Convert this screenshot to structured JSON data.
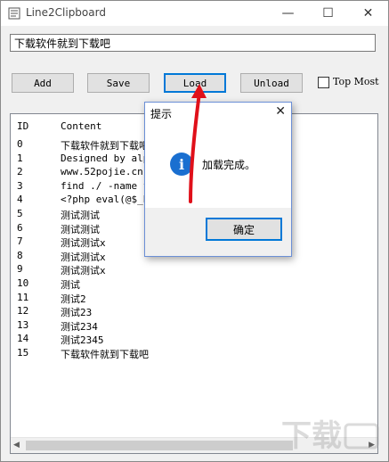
{
  "window": {
    "title": "Line2Clipboard"
  },
  "input": {
    "value": "下载软件就到下载吧"
  },
  "toolbar": {
    "add_label": "Add",
    "save_label": "Save",
    "load_label": "Load",
    "unload_label": "Unload",
    "topmost_label": "Top Most",
    "topmost_checked": false
  },
  "list": {
    "columns": [
      "ID",
      "Content"
    ],
    "rows": [
      {
        "id": "0",
        "content": "下载软件就到下载吧"
      },
      {
        "id": "1",
        "content": "Designed by alpe"
      },
      {
        "id": "2",
        "content": "www.52pojie.cn"
      },
      {
        "id": "3",
        "content": "find ./ -name fl"
      },
      {
        "id": "4",
        "content": "<?php eval(@$_PO"
      },
      {
        "id": "5",
        "content": "测试测试"
      },
      {
        "id": "6",
        "content": "测试测试"
      },
      {
        "id": "7",
        "content": "测试测试x"
      },
      {
        "id": "8",
        "content": "测试测试x"
      },
      {
        "id": "9",
        "content": "测试测试x"
      },
      {
        "id": "10",
        "content": "测试"
      },
      {
        "id": "11",
        "content": "测试2"
      },
      {
        "id": "12",
        "content": "测试23"
      },
      {
        "id": "13",
        "content": "测试234"
      },
      {
        "id": "14",
        "content": "测试2345"
      },
      {
        "id": "15",
        "content": "下载软件就到下载吧"
      }
    ]
  },
  "dialog": {
    "title": "提示",
    "message": "加载完成。",
    "ok_label": "确定"
  },
  "colors": {
    "accent": "#0078d7",
    "annotation_arrow": "#e0101a",
    "info_icon": "#1a6fd0"
  }
}
